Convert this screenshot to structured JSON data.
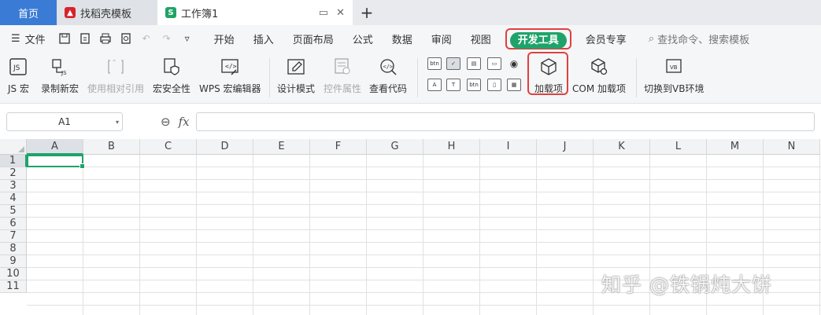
{
  "tabs": {
    "home": "首页",
    "template": "找稻壳模板",
    "workbook": "工作簿1",
    "add": "+"
  },
  "menu": {
    "file": "文件",
    "items": [
      "开始",
      "插入",
      "页面布局",
      "公式",
      "数据",
      "审阅",
      "视图"
    ],
    "developer": "开发工具",
    "member": "会员专享",
    "search_placeholder": "查找命令、搜索模板"
  },
  "ribbon": {
    "js_macro": "JS 宏",
    "record_macro": "录制新宏",
    "relative_ref": "使用相对引用",
    "macro_security": "宏安全性",
    "wps_macro_editor": "WPS 宏编辑器",
    "design_mode": "设计模式",
    "control_props": "控件属性",
    "view_code": "查看代码",
    "addins": "加载项",
    "com_addins": "COM 加载项",
    "switch_vb": "切换到VB环境",
    "mini_btn": "btn"
  },
  "formula_bar": {
    "name_box": "A1",
    "fx": "fx"
  },
  "grid": {
    "columns": [
      "A",
      "B",
      "C",
      "D",
      "E",
      "F",
      "G",
      "H",
      "I",
      "J",
      "K",
      "L",
      "M",
      "N"
    ],
    "rows": [
      "1",
      "2",
      "3",
      "4",
      "5",
      "6",
      "7",
      "8",
      "9",
      "10",
      "11"
    ],
    "selected_cell": "A1"
  },
  "watermark": "知乎 @铁锅炖大饼",
  "colors": {
    "accent_green": "#1fa36b",
    "highlight_red": "#e04040",
    "home_tab_blue": "#3a7bd5"
  }
}
